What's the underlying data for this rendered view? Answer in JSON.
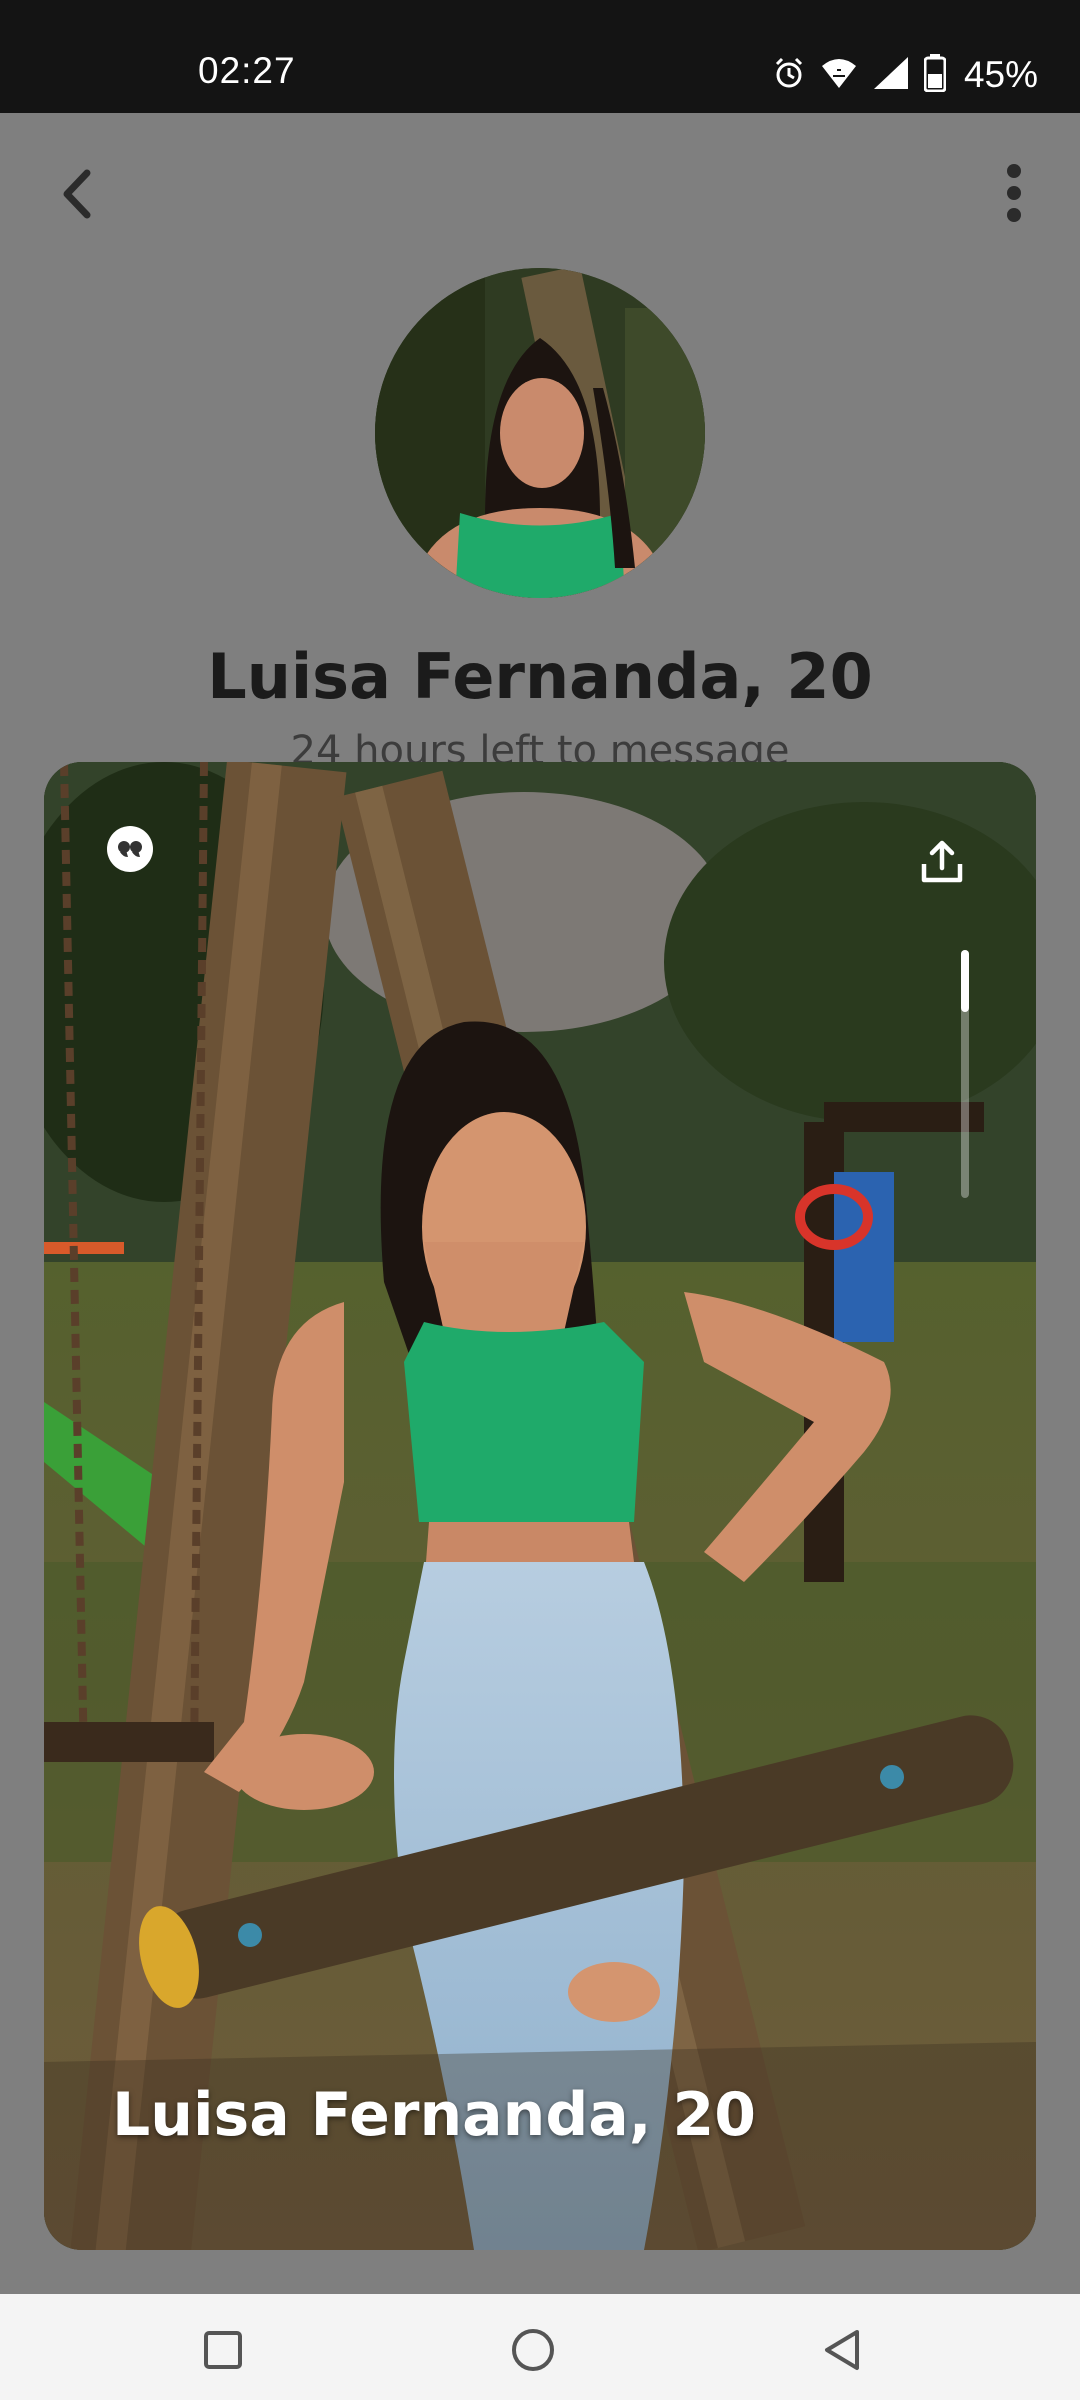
{
  "status_bar": {
    "time": "02:27",
    "battery_percent": "45%",
    "icons": [
      "alarm-icon",
      "wifi-icon",
      "signal-icon",
      "battery-icon"
    ]
  },
  "header": {
    "back_icon": "chevron-left-icon",
    "more_icon": "more-vertical-icon"
  },
  "profile": {
    "name": "Luisa Fernanda, 20",
    "time_left": "24 hours left to message"
  },
  "photo_card": {
    "name": "Luisa Fernanda, 20",
    "quote_icon": "quote-icon",
    "share_icon": "share-icon",
    "photo_index": 1,
    "photo_count": 4
  },
  "nav_bar": {
    "icons": [
      "recents-square-icon",
      "home-circle-icon",
      "back-triangle-icon"
    ]
  },
  "colors": {
    "overlay": "#7f7f7f",
    "status_bar": "#141414",
    "nav_bar": "#f4f4f4",
    "name_text": "#1b1b1b",
    "shirt_green": "#1faa6a"
  }
}
